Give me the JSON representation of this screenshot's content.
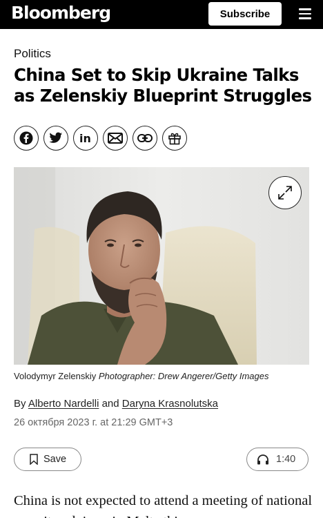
{
  "header": {
    "logo": "Bloomberg",
    "subscribe_label": "Subscribe",
    "menu_icon": "hamburger-menu-icon"
  },
  "article": {
    "section": "Politics",
    "headline": "China Set to Skip Ukraine Talks as Zelenskiy Blueprint Struggles",
    "share_icons": [
      "facebook-icon",
      "twitter-icon",
      "linkedin-icon",
      "email-icon",
      "link-icon",
      "gift-icon"
    ],
    "caption": {
      "subject": "Volodymyr Zelenskiy",
      "credit": "Photographer: Drew Angerer/Getty Images"
    },
    "byline": {
      "prefix": "By",
      "author1": "Alberto Nardelli",
      "conjunction": "and",
      "author2": "Daryna Krasnolutska"
    },
    "date": "26 октября 2023 г. at 21:29 GMT+3",
    "save_label": "Save",
    "listen_duration": "1:40",
    "body": "China is not expected to attend a meeting of national security advisers in Malta this"
  },
  "colors": {
    "topbar": "#000000",
    "text": "#111111",
    "muted": "#666666"
  }
}
